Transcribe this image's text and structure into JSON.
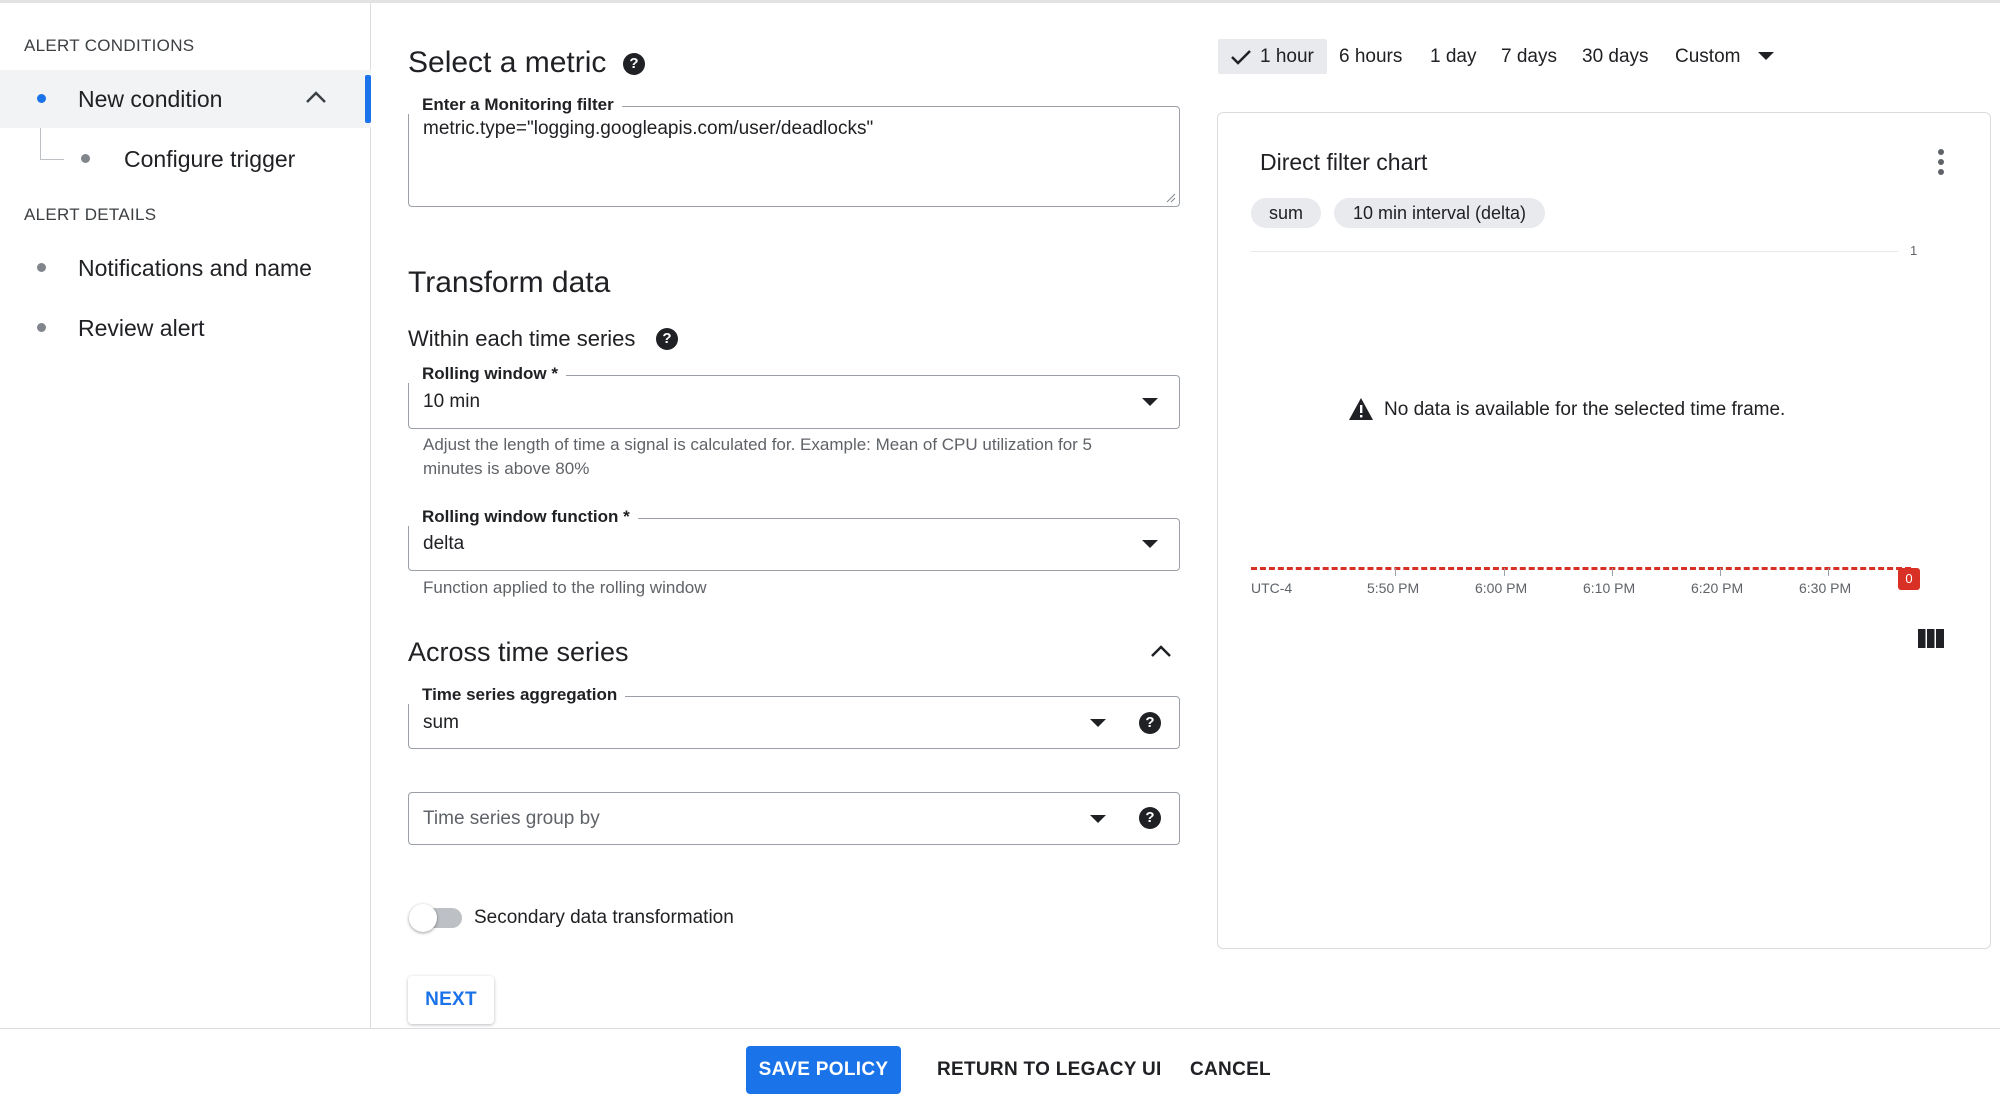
{
  "sidebar": {
    "alert_conditions_heading": "ALERT CONDITIONS",
    "new_condition": "New condition",
    "configure_trigger": "Configure trigger",
    "alert_details_heading": "ALERT DETAILS",
    "notifications": "Notifications and name",
    "review": "Review alert",
    "accent": "#1a73e8"
  },
  "main": {
    "select_metric_title": "Select a metric",
    "filter_label": "Enter a Monitoring filter",
    "filter_value": "metric.type=\"logging.googleapis.com/user/deadlocks\"",
    "transform_title": "Transform data",
    "within_title": "Within each time series",
    "rolling_window_label": "Rolling window *",
    "rolling_window_value": "10 min",
    "rolling_window_help1": "Adjust the length of time a signal is calculated for. Example: Mean of CPU utilization for 5",
    "rolling_window_help2": "minutes is above 80%",
    "rolling_fn_label": "Rolling window function *",
    "rolling_fn_value": "delta",
    "rolling_fn_help": "Function applied to the rolling window",
    "across_title": "Across time series",
    "aggregation_label": "Time series aggregation",
    "aggregation_value": "sum",
    "group_by_placeholder": "Time series group by",
    "secondary_toggle_label": "Secondary data transformation",
    "secondary_toggle_on": false,
    "next_label": "NEXT"
  },
  "time_range": {
    "options": [
      "1 hour",
      "6 hours",
      "1 day",
      "7 days",
      "30 days",
      "Custom"
    ],
    "selected": "1 hour"
  },
  "chart": {
    "title": "Direct filter chart",
    "chips": [
      "sum",
      "10 min interval (delta)"
    ],
    "no_data": "No data is available for the selected time frame.",
    "threshold_color": "#d93025"
  },
  "chart_data": {
    "type": "line",
    "title": "Direct filter chart",
    "x_ticks": [
      "UTC-4",
      "5:50 PM",
      "6:00 PM",
      "6:10 PM",
      "6:20 PM",
      "6:30 PM"
    ],
    "y_ticks": [
      "1"
    ],
    "threshold": 0,
    "threshold_label": "0",
    "series": []
  },
  "footer": {
    "save": "SAVE POLICY",
    "legacy": "RETURN TO LEGACY UI",
    "cancel": "CANCEL"
  }
}
